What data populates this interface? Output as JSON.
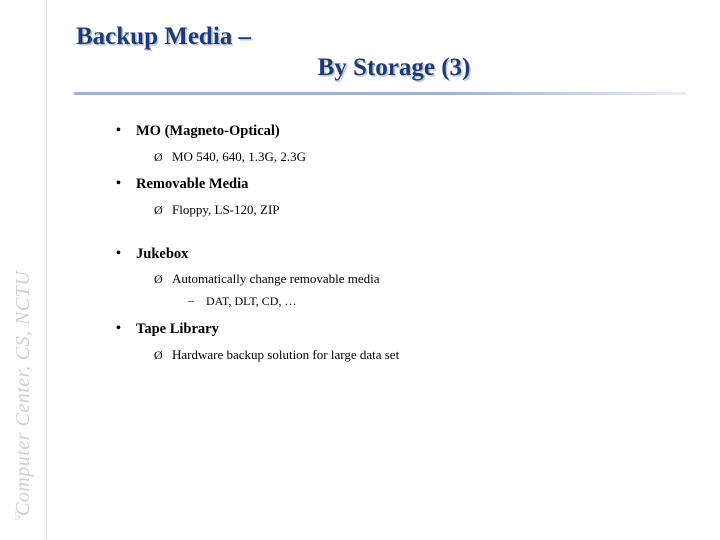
{
  "sidebar": {
    "label": "Computer Center, CS, NCTU",
    "page_number": "5"
  },
  "title": {
    "line1": "Backup Media –",
    "line2": "By Storage (3)"
  },
  "bullets": {
    "b1": "MO (Magneto-Optical)",
    "b1s1": "MO 540, 640, 1.3G, 2.3G",
    "b2": "Removable Media",
    "b2s1": "Floppy, LS-120, ZIP",
    "b3": "Jukebox",
    "b3s1": "Automatically change removable media",
    "b3s1a": "DAT, DLT, CD, …",
    "b4": "Tape Library",
    "b4s1": "Hardware backup solution for large data set"
  },
  "icons": {
    "disc_bullet": "•",
    "arrow_bullet": "Ø",
    "dash_bullet": "–"
  },
  "colors": {
    "title_blue": "#1f3b73",
    "title_shadow": "#b9c6de",
    "rule": "#9fb3d4",
    "sidebar_text": "#cfcfcf"
  }
}
